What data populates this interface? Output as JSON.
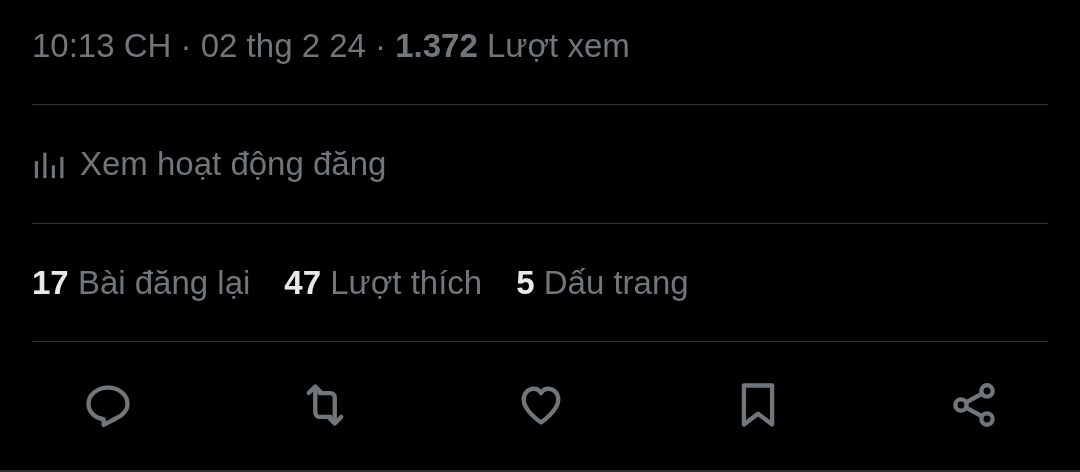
{
  "meta": "10:13 CH · 02 thg 2 24 · **1.372** Lượt xem",
  "activity": {
    "label": "Xem hoạt động đăng"
  },
  "stats": [
    {
      "count": "17",
      "label": "Bài đăng lại"
    },
    {
      "count": "47",
      "label": "Lượt thích"
    },
    {
      "count": "5",
      "label": "Dấu trang"
    }
  ],
  "actions": [
    {
      "kind": "reply"
    },
    {
      "kind": "repost"
    },
    {
      "kind": "like"
    },
    {
      "kind": "bookmark"
    },
    {
      "kind": "share"
    }
  ]
}
